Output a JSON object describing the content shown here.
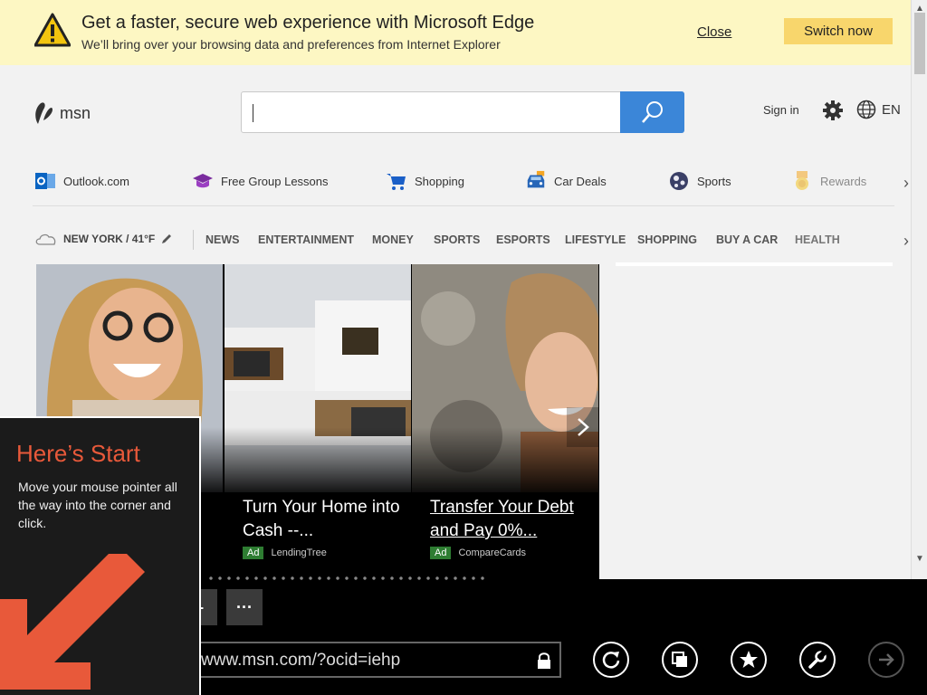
{
  "banner": {
    "title": "Get a faster, secure web experience with Microsoft Edge",
    "subtitle": "We’ll bring over your browsing data and preferences from Internet Explorer",
    "close_label": "Close",
    "switch_label": "Switch now"
  },
  "header": {
    "logo_text": "msn",
    "search_value": "",
    "signin_label": "Sign in",
    "lang_label": "EN"
  },
  "quick_links": [
    {
      "label": "Outlook.com",
      "icon": "outlook-icon"
    },
    {
      "label": "Free Group Lessons",
      "icon": "graduation-cap-icon"
    },
    {
      "label": "Shopping",
      "icon": "shopping-cart-icon"
    },
    {
      "label": "Car Deals",
      "icon": "car-icon"
    },
    {
      "label": "Sports",
      "icon": "soccer-ball-icon"
    },
    {
      "label": "Rewards",
      "icon": "medal-icon"
    }
  ],
  "weather": {
    "label": "NEW YORK / 41°F"
  },
  "nav": [
    "NEWS",
    "ENTERTAINMENT",
    "MONEY",
    "SPORTS",
    "ESPORTS",
    "LIFESTYLE",
    "SHOPPING",
    "BUY A CAR",
    "HEALTH"
  ],
  "cards": [
    {
      "title": "",
      "ad_badge": "",
      "source": ""
    },
    {
      "title": "Turn Your Home into Cash --...",
      "ad_badge": "Ad",
      "source": "LendingTree"
    },
    {
      "title": "Transfer Your Debt and Pay 0%...",
      "ad_badge": "Ad",
      "source": "CompareCards"
    }
  ],
  "appbar": {
    "more_label": "···",
    "address": "www.msn.com/?ocid=iehp"
  },
  "tip": {
    "heading": "Here’s Start",
    "body": "Move your mouse pointer all the way into the corner and click."
  },
  "colors": {
    "banner_bg": "#fdf7c3",
    "switch_button": "#f8d66c",
    "search_button": "#3b86d8",
    "tip_heading": "#e8593a",
    "ad_badge": "#2e7d32"
  }
}
